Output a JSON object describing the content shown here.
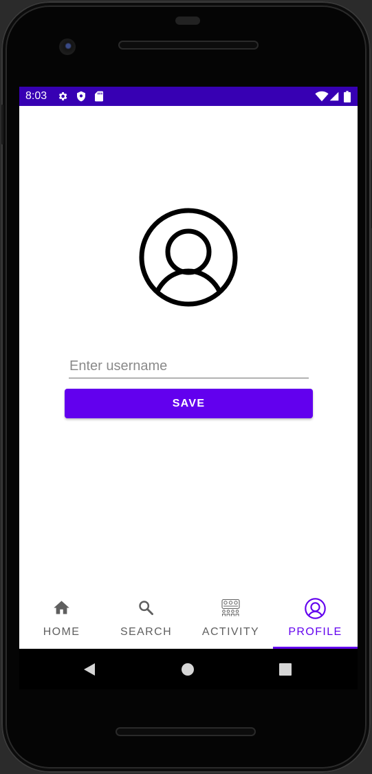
{
  "status_bar": {
    "time": "8:03",
    "left_icons": [
      "gear-icon",
      "shield-icon",
      "sd-card-icon"
    ],
    "right_icons": [
      "wifi-icon",
      "cell-signal-icon",
      "battery-icon"
    ],
    "color": "#3700b3"
  },
  "profile": {
    "avatar_icon": "account-circle-icon",
    "username_placeholder": "Enter username",
    "username_value": "",
    "save_label": "SAVE"
  },
  "bottom_nav": {
    "items": [
      {
        "label": "HOME",
        "icon": "home-icon"
      },
      {
        "label": "SEARCH",
        "icon": "search-icon"
      },
      {
        "label": "ACTIVITY",
        "icon": "activity-icon"
      },
      {
        "label": "PROFILE",
        "icon": "account-circle-icon"
      }
    ],
    "active": "PROFILE"
  },
  "colors": {
    "primary": "#6200ee",
    "primary_dark": "#3700b3",
    "inactive": "#5f5f5f"
  },
  "system_nav": [
    "back-icon",
    "home-circle-icon",
    "recents-icon"
  ]
}
